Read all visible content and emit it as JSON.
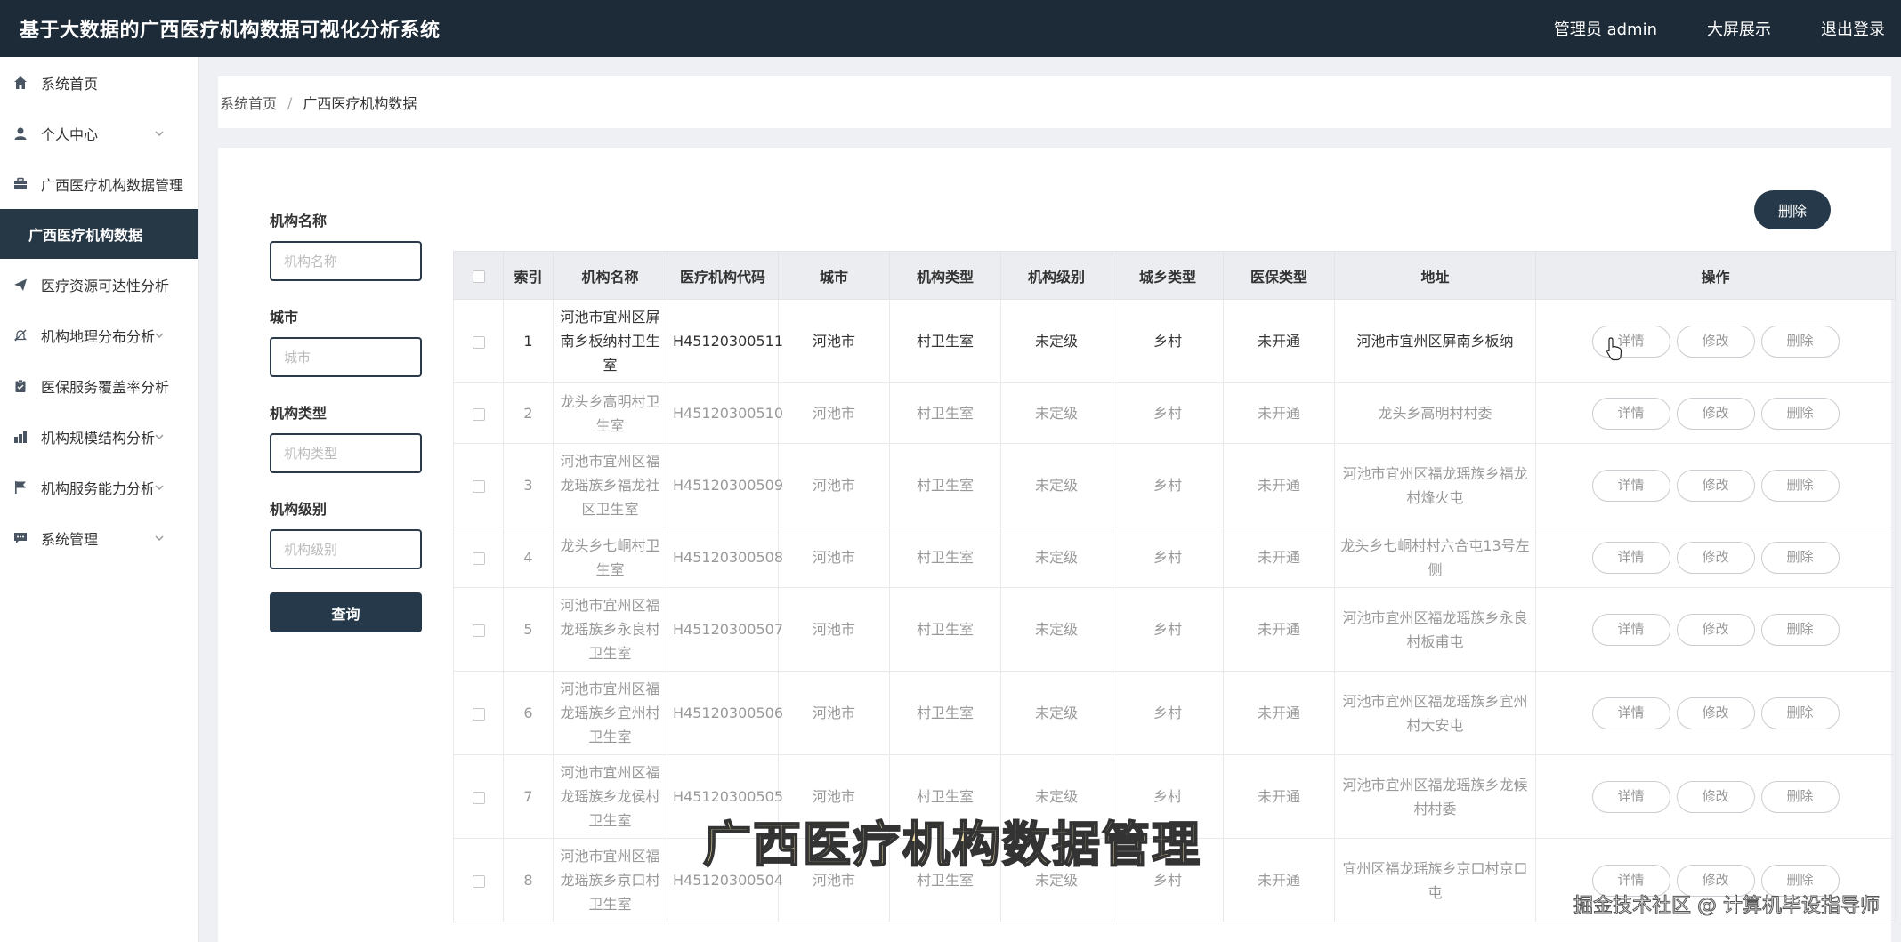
{
  "header": {
    "title": "基于大数据的广西医疗机构数据可视化分析系统",
    "admin": "管理员 admin",
    "bigscreen": "大屏展示",
    "logout": "退出登录"
  },
  "sidebar": {
    "items": [
      {
        "label": "系统首页",
        "icon": "home-icon"
      },
      {
        "label": "个人中心",
        "icon": "user-icon"
      },
      {
        "label": "广西医疗机构数据管理",
        "icon": "briefcase-icon"
      },
      {
        "label": "广西医疗机构数据",
        "icon": ""
      },
      {
        "label": "医疗资源可达性分析",
        "icon": "send-icon"
      },
      {
        "label": "机构地理分布分析",
        "icon": "bell-off-icon"
      },
      {
        "label": "医保服务覆盖率分析",
        "icon": "clipboard-icon"
      },
      {
        "label": "机构规模结构分析",
        "icon": "chart-icon"
      },
      {
        "label": "机构服务能力分析",
        "icon": "flag-icon"
      },
      {
        "label": "系统管理",
        "icon": "message-icon"
      }
    ]
  },
  "breadcrumb": {
    "home": "系统首页",
    "sep": "/",
    "current": "广西医疗机构数据"
  },
  "search": {
    "name_label": "机构名称",
    "name_placeholder": "机构名称",
    "city_label": "城市",
    "city_placeholder": "城市",
    "type_label": "机构类型",
    "type_placeholder": "机构类型",
    "level_label": "机构级别",
    "level_placeholder": "机构级别",
    "query_label": "查询"
  },
  "toolbar": {
    "delete_label": "删除"
  },
  "table": {
    "headers": [
      "索引",
      "机构名称",
      "医疗机构代码",
      "城市",
      "机构类型",
      "机构级别",
      "城乡类型",
      "医保类型",
      "地址",
      "操作"
    ],
    "actions": {
      "detail": "详情",
      "edit": "修改",
      "delete": "删除"
    },
    "rows": [
      {
        "index": "1",
        "name": "河池市宜州区屏南乡板纳村卫生室",
        "code": "H45120300511",
        "city": "河池市",
        "type": "村卫生室",
        "level": "未定级",
        "area": "乡村",
        "insurance": "未开通",
        "address": "河池市宜州区屏南乡板纳"
      },
      {
        "index": "2",
        "name": "龙头乡高明村卫生室",
        "code": "H45120300510",
        "city": "河池市",
        "type": "村卫生室",
        "level": "未定级",
        "area": "乡村",
        "insurance": "未开通",
        "address": "龙头乡高明村村委"
      },
      {
        "index": "3",
        "name": "河池市宜州区福龙瑶族乡福龙社区卫生室",
        "code": "H45120300509",
        "city": "河池市",
        "type": "村卫生室",
        "level": "未定级",
        "area": "乡村",
        "insurance": "未开通",
        "address": "河池市宜州区福龙瑶族乡福龙村烽火屯"
      },
      {
        "index": "4",
        "name": "龙头乡七峒村卫生室",
        "code": "H45120300508",
        "city": "河池市",
        "type": "村卫生室",
        "level": "未定级",
        "area": "乡村",
        "insurance": "未开通",
        "address": "龙头乡七峒村村六合屯13号左侧"
      },
      {
        "index": "5",
        "name": "河池市宜州区福龙瑶族乡永良村卫生室",
        "code": "H45120300507",
        "city": "河池市",
        "type": "村卫生室",
        "level": "未定级",
        "area": "乡村",
        "insurance": "未开通",
        "address": "河池市宜州区福龙瑶族乡永良村板甫屯"
      },
      {
        "index": "6",
        "name": "河池市宜州区福龙瑶族乡宜州村卫生室",
        "code": "H45120300506",
        "city": "河池市",
        "type": "村卫生室",
        "level": "未定级",
        "area": "乡村",
        "insurance": "未开通",
        "address": "河池市宜州区福龙瑶族乡宜州村大安屯"
      },
      {
        "index": "7",
        "name": "河池市宜州区福龙瑶族乡龙侯村卫生室",
        "code": "H45120300505",
        "city": "河池市",
        "type": "村卫生室",
        "level": "未定级",
        "area": "乡村",
        "insurance": "未开通",
        "address": "河池市宜州区福龙瑶族乡龙候村村委"
      },
      {
        "index": "8",
        "name": "河池市宜州区福龙瑶族乡京口村卫生室",
        "code": "H45120300504",
        "city": "河池市",
        "type": "村卫生室",
        "level": "未定级",
        "area": "乡村",
        "insurance": "未开通",
        "address": "宜州区福龙瑶族乡京口村京口屯"
      }
    ]
  },
  "overlay": {
    "caption": "广西医疗机构数据管理",
    "watermark": "掘金技术社区 @ 计算机毕设指导师"
  },
  "colors": {
    "header_bg": "#1d2b38",
    "accent": "#26394a"
  }
}
